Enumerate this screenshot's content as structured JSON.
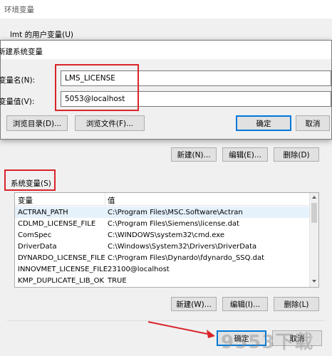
{
  "outer": {
    "title": "环境变量",
    "user_vars_label": "lmt 的用户变量(U)"
  },
  "dialog": {
    "title": "新建系统变量",
    "name_label": "变量名(N):",
    "name_value": "LMS_LICENSE",
    "value_label": "变量值(V):",
    "value_value": "5053@localhost",
    "browse_dir": "浏览目录(D)...",
    "browse_file": "浏览文件(F)...",
    "ok": "确定",
    "cancel": "取消"
  },
  "user_buttons": {
    "new": "新建(N)...",
    "edit": "编辑(E)...",
    "delete": "删除(D)"
  },
  "system": {
    "label": "系统变量(S)",
    "col_var": "变量",
    "col_val": "值",
    "rows": [
      {
        "name": "ACTRAN_PATH",
        "value": "C:\\Program Files\\MSC.Software\\Actran"
      },
      {
        "name": "CDLMD_LICENSE_FILE",
        "value": "C:\\Program Files\\Siemens\\license.dat"
      },
      {
        "name": "ComSpec",
        "value": "C:\\WINDOWS\\system32\\cmd.exe"
      },
      {
        "name": "DriverData",
        "value": "C:\\Windows\\System32\\Drivers\\DriverData"
      },
      {
        "name": "DYNARDO_LICENSE_FILE",
        "value": "C:\\Program Files\\Dynardo\\fdynardo_SSQ.dat"
      },
      {
        "name": "INNOVMET_LICENSE_FILE",
        "value": "23100@localhost"
      },
      {
        "name": "KMP_DUPLICATE_LIB_OK",
        "value": "TRUE"
      }
    ],
    "buttons": {
      "new": "新建(W)...",
      "edit": "编辑(I)...",
      "delete": "删除(L)"
    }
  },
  "footer": {
    "ok": "确定",
    "cancel": "取消"
  },
  "watermark": "9553下载",
  "colors": {
    "annotation_red": "#d9242a",
    "accent": "#0078d7",
    "selected_row": "#e5f1fb"
  }
}
